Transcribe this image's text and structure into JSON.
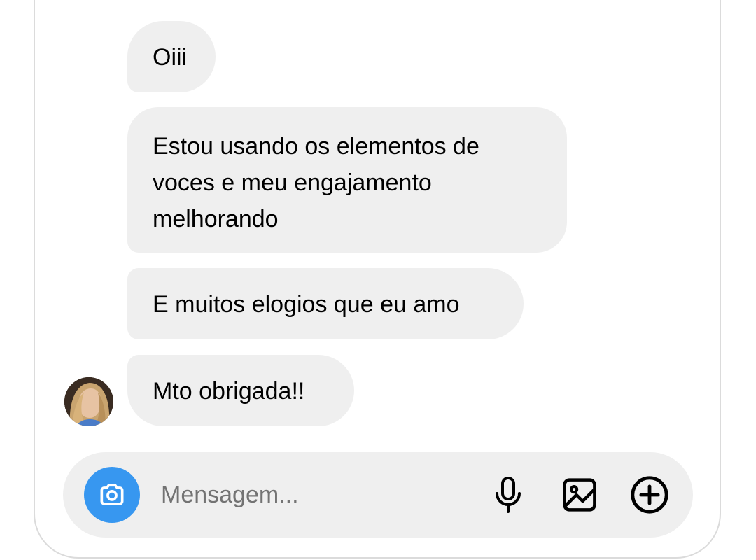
{
  "messages": [
    {
      "text": "Oiii"
    },
    {
      "text": "Estou usando os elementos de voces e meu engajamento melhorando"
    },
    {
      "text": "E muitos elogios que eu amo"
    },
    {
      "text": "Mto obrigada!!"
    }
  ],
  "sender": {
    "avatar_icon": "profile-photo"
  },
  "composer": {
    "placeholder": "Mensagem...",
    "camera_icon": "camera-icon",
    "mic_icon": "microphone-icon",
    "gallery_icon": "image-icon",
    "more_icon": "plus-circle-icon"
  },
  "colors": {
    "bubble_bg": "#efefef",
    "composer_bg": "#efefef",
    "camera_button": "#3797f0",
    "placeholder": "#737373"
  }
}
